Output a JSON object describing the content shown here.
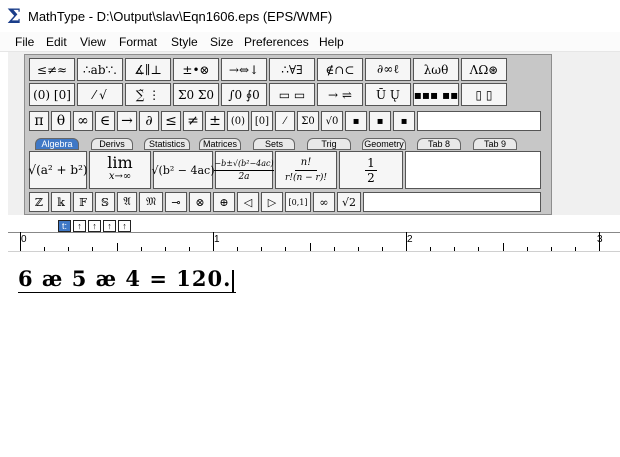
{
  "window": {
    "title": "MathType - D:\\Output\\slav\\Eqn1606.eps (EPS/WMF)",
    "app_icon": "Σ"
  },
  "menu": [
    "File",
    "Edit",
    "View",
    "Format",
    "Style",
    "Size",
    "Preferences",
    "Help"
  ],
  "palette_row1": [
    "≤≠≈",
    "∴ab∵.",
    "∡∥⊥",
    "±•⊗",
    "→⇔↓",
    "∴∀∃",
    "∉∩⊂",
    "∂∞ℓ",
    "λωθ",
    "ΛΩ⊛"
  ],
  "palette_row2": [
    "(0) [0]",
    "⁄ √",
    "∑̃ ⋮",
    "Σ0 Σ0",
    "∫0 ∮0",
    "▭ ▭",
    "→ ⇌",
    "Ū Ų",
    "▪▪▪ ▪▪",
    "▯ ▯"
  ],
  "small_row": [
    "π",
    "θ",
    "∞",
    "∈",
    "→",
    "∂",
    "≤",
    "≠",
    "±",
    "(0)",
    "[0]",
    "⁄",
    "Σ0",
    "√0",
    "▪",
    "▪",
    "▪"
  ],
  "tabs": [
    "Algebra",
    "Derivs",
    "Statistics",
    "Matrices",
    "Sets",
    "Trig",
    "Geometry",
    "Tab 8",
    "Tab 9"
  ],
  "templates": {
    "sqrt": "√(a² + b²)",
    "lim_top": "lim",
    "lim_bottom": "x→∞",
    "sqrt2": "√(b² − 4ac)",
    "quad_top": "−b±√(b²−4ac)",
    "quad_bottom": "2a",
    "comb_top": "n!",
    "comb_bottom": "r!(n − r)!",
    "half_top": "1",
    "half_bottom": "2"
  },
  "symbol_row": [
    "ℤ",
    "𝕜",
    "𝔽",
    "𝕊",
    "𝔄",
    "𝔐",
    "⊸",
    "⊗",
    "⊕",
    "◁",
    "▷",
    "[0,1]",
    "∞",
    "√2"
  ],
  "mini_tools": [
    "t:",
    "↑",
    "↑",
    "↑",
    "↑"
  ],
  "ruler_labels": [
    "0",
    "1",
    "2",
    "3"
  ],
  "equation": "6 æ 5 æ 4 = 120."
}
